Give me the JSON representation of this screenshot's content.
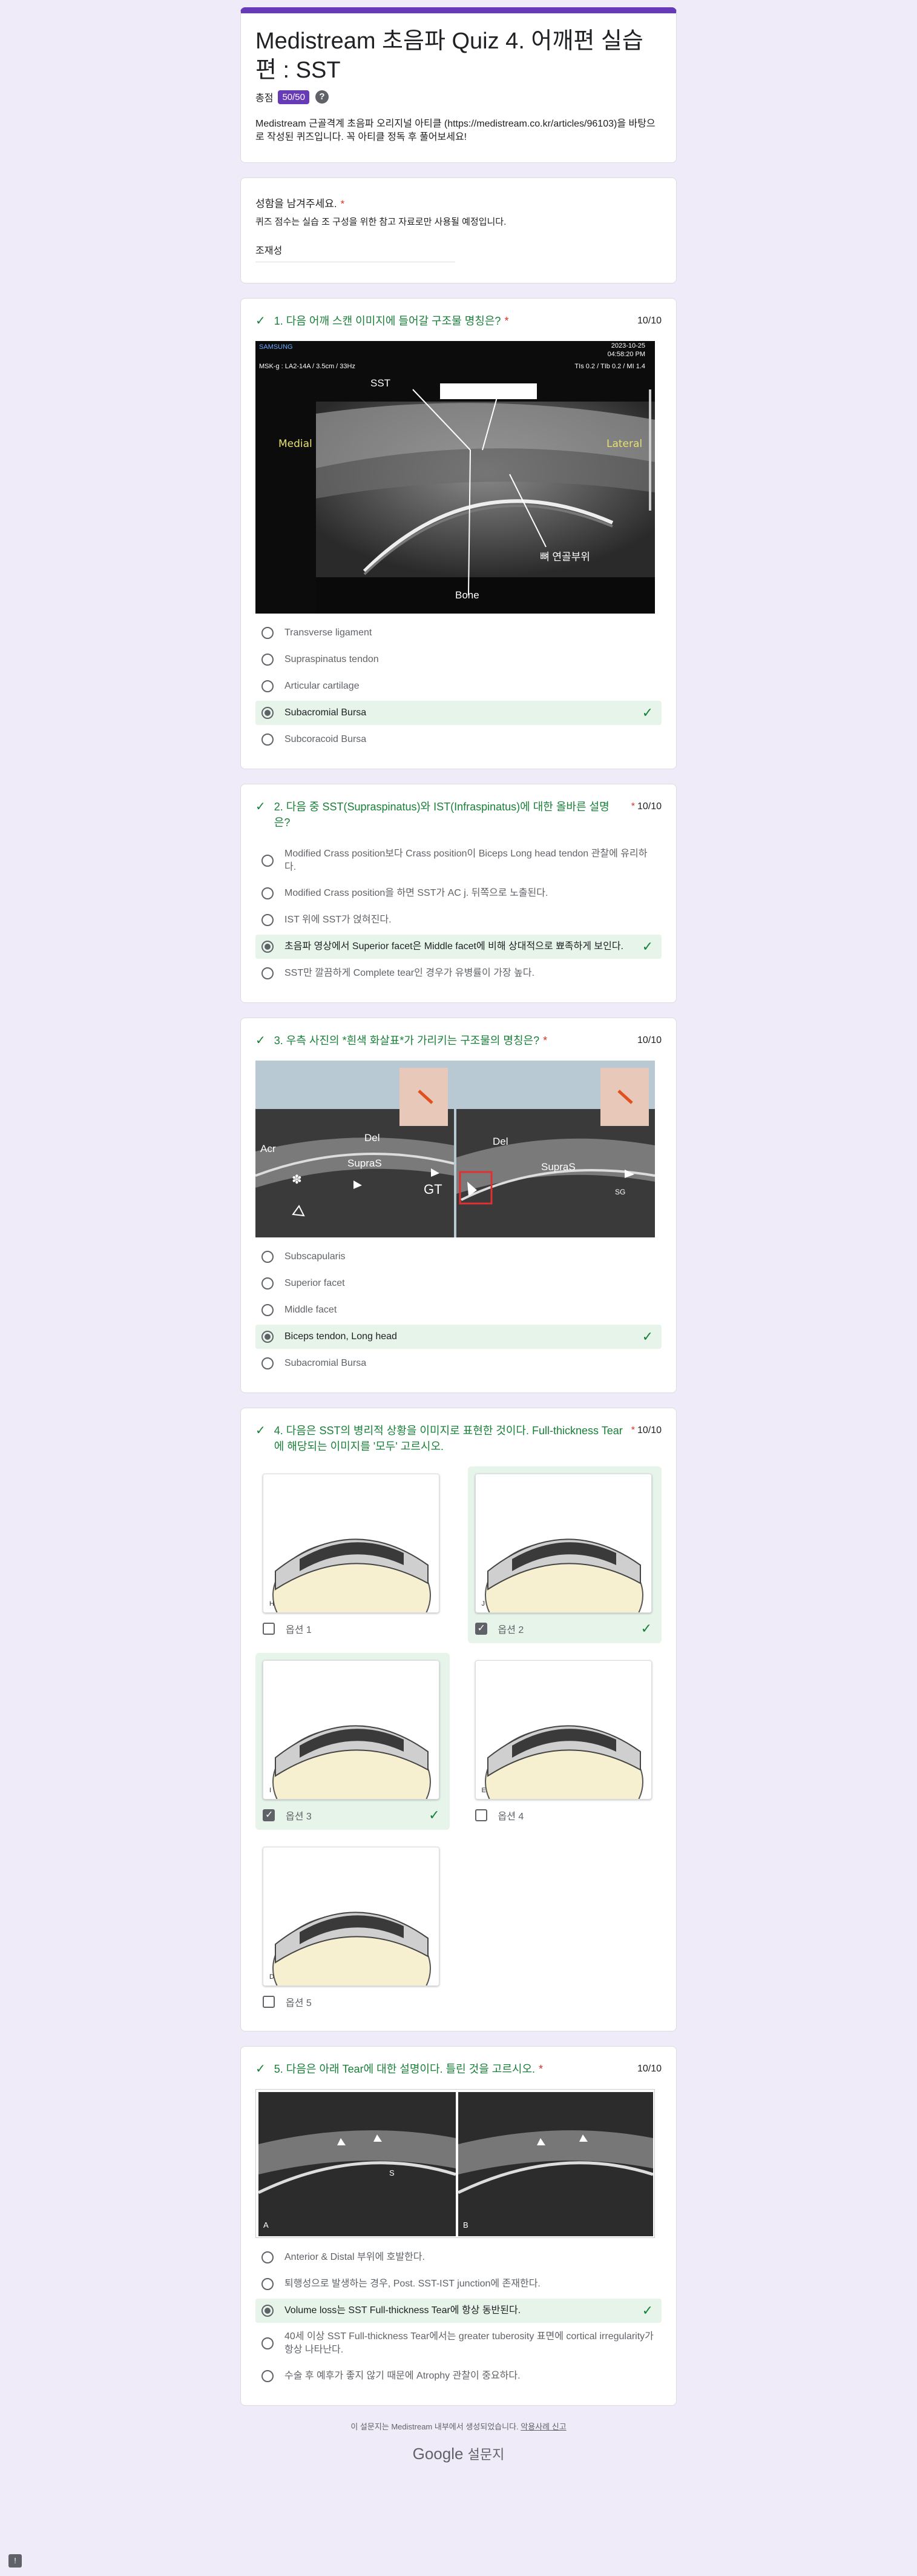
{
  "form": {
    "title": "Medistream 초음파 Quiz 4. 어깨편 실습편 : SST",
    "score_label": "총점",
    "score": "50/50",
    "help": "?",
    "description": "Medistream 근골격계 초음파 오리지널 아티클 (https://medistream.co.kr/articles/96103)을 바탕으로 작성된 퀴즈입니다. 꼭 아티클 정독 후 풀어보세요!"
  },
  "name_q": {
    "title": "성함을 남겨주세요.",
    "required": "*",
    "desc": "퀴즈 점수는 실습 조 구성을 위한 참고 자료로만 사용될 예정입니다.",
    "answer": "조재성"
  },
  "q1": {
    "check": "✓",
    "title": "1. 다음 어깨 스캔 이미지에 들어갈 구조물 명칭은?",
    "required": "*",
    "points": "10/10",
    "image": {
      "brand": "SAMSUNG",
      "date": "2023-10-25",
      "time": "04:58:20 PM",
      "probe": "MSK-g : LA2-14A / 3.5cm / 33Hz",
      "ti": "TIs 0.2 / TIb 0.2 / MI 1.4",
      "label_sst": "SST",
      "label_medial": "Medial",
      "label_lateral": "Lateral",
      "label_cartilage": "뼈 연골부위",
      "label_bone": "Bone"
    },
    "options": [
      {
        "label": "Transverse ligament",
        "selected": false,
        "correct": false
      },
      {
        "label": "Supraspinatus tendon",
        "selected": false,
        "correct": false
      },
      {
        "label": "Articular cartilage",
        "selected": false,
        "correct": false
      },
      {
        "label": "Subacromial Bursa",
        "selected": true,
        "correct": true
      },
      {
        "label": "Subcoracoid Bursa",
        "selected": false,
        "correct": false
      }
    ]
  },
  "q2": {
    "check": "✓",
    "title": "2. 다음 중 SST(Supraspinatus)와 IST(Infraspinatus)에 대한 올바른 설명은?",
    "required": "*",
    "points": "10/10",
    "options": [
      {
        "label": "Modified Crass position보다 Crass position이 Biceps Long head tendon 관찰에 유리하다.",
        "selected": false,
        "correct": false
      },
      {
        "label": "Modified Crass position을 하면 SST가 AC j. 뒤쪽으로 노출된다.",
        "selected": false,
        "correct": false
      },
      {
        "label": "IST 위에 SST가 얹혀진다.",
        "selected": false,
        "correct": false
      },
      {
        "label": "초음파 영상에서 Superior facet은 Middle facet에 비해 상대적으로 뾰족하게 보인다.",
        "selected": true,
        "correct": true
      },
      {
        "label": "SST만 깔끔하게 Complete tear인 경우가 유병률이 가장 높다.",
        "selected": false,
        "correct": false
      }
    ]
  },
  "q3": {
    "check": "✓",
    "title": "3. 우측 사진의 *흰색 화살표*가 가리키는 구조물의 명칭은?",
    "required": "*",
    "points": "10/10",
    "image": {
      "l_acr": "Acr",
      "l_del": "Del",
      "l_supras": "SupraS",
      "l_gt": "GT",
      "r_del": "Del",
      "r_supras": "SupraS",
      "r_sg": "SG",
      "asterisk": "✽"
    },
    "options": [
      {
        "label": "Subscapularis",
        "selected": false,
        "correct": false
      },
      {
        "label": "Superior facet",
        "selected": false,
        "correct": false
      },
      {
        "label": "Middle facet",
        "selected": false,
        "correct": false
      },
      {
        "label": "Biceps tendon, Long head",
        "selected": true,
        "correct": true
      },
      {
        "label": "Subacromial Bursa",
        "selected": false,
        "correct": false
      }
    ]
  },
  "q4": {
    "check": "✓",
    "title": "4. 다음은 SST의 병리적 상황을 이미지로 표현한 것이다. Full-thickness Tear에 해당되는 이미지를 '모두' 고르시오.",
    "required": "*",
    "points": "10/10",
    "options": [
      {
        "label": "옵션 1",
        "letter": "H",
        "checked": false,
        "correct": false
      },
      {
        "label": "옵션 2",
        "letter": "J",
        "checked": true,
        "correct": true
      },
      {
        "label": "옵션 3",
        "letter": "I",
        "checked": true,
        "correct": true
      },
      {
        "label": "옵션 4",
        "letter": "E",
        "checked": false,
        "correct": false
      },
      {
        "label": "옵션 5",
        "letter": "D",
        "checked": false,
        "correct": false
      }
    ]
  },
  "q5": {
    "check": "✓",
    "title": "5. 다음은 아래 Tear에 대한 설명이다. 틀린 것을 고르시오.",
    "required": "*",
    "points": "10/10",
    "image": {
      "left": "A",
      "right": "B",
      "s": "S"
    },
    "options": [
      {
        "label": "Anterior & Distal 부위에 호발한다.",
        "selected": false,
        "correct": false
      },
      {
        "label": "퇴행성으로 발생하는 경우, Post. SST-IST junction에 존재한다.",
        "selected": false,
        "correct": false
      },
      {
        "label": "Volume loss는 SST Full-thickness Tear에 항상 동반된다.",
        "selected": true,
        "correct": true
      },
      {
        "label": "40세 이상 SST Full-thickness Tear에서는 greater tuberosity 표면에 cortical irregularity가 항상 나타난다.",
        "selected": false,
        "correct": false
      },
      {
        "label": "수술 후 예후가 좋지 않기 때문에 Atrophy 관찰이 중요하다.",
        "selected": false,
        "correct": false
      }
    ]
  },
  "footer": {
    "text": "이 설문지는 Medistream 내부에서 생성되었습니다.",
    "report": "악용사례 신고",
    "brand_google": "Google",
    "brand_forms": "설문지",
    "feedback": "!"
  },
  "colors": {
    "accent": "#673ab7",
    "correct": "#188038",
    "correct_bg": "#e6f4ea",
    "bg": "#f0ebf8"
  }
}
